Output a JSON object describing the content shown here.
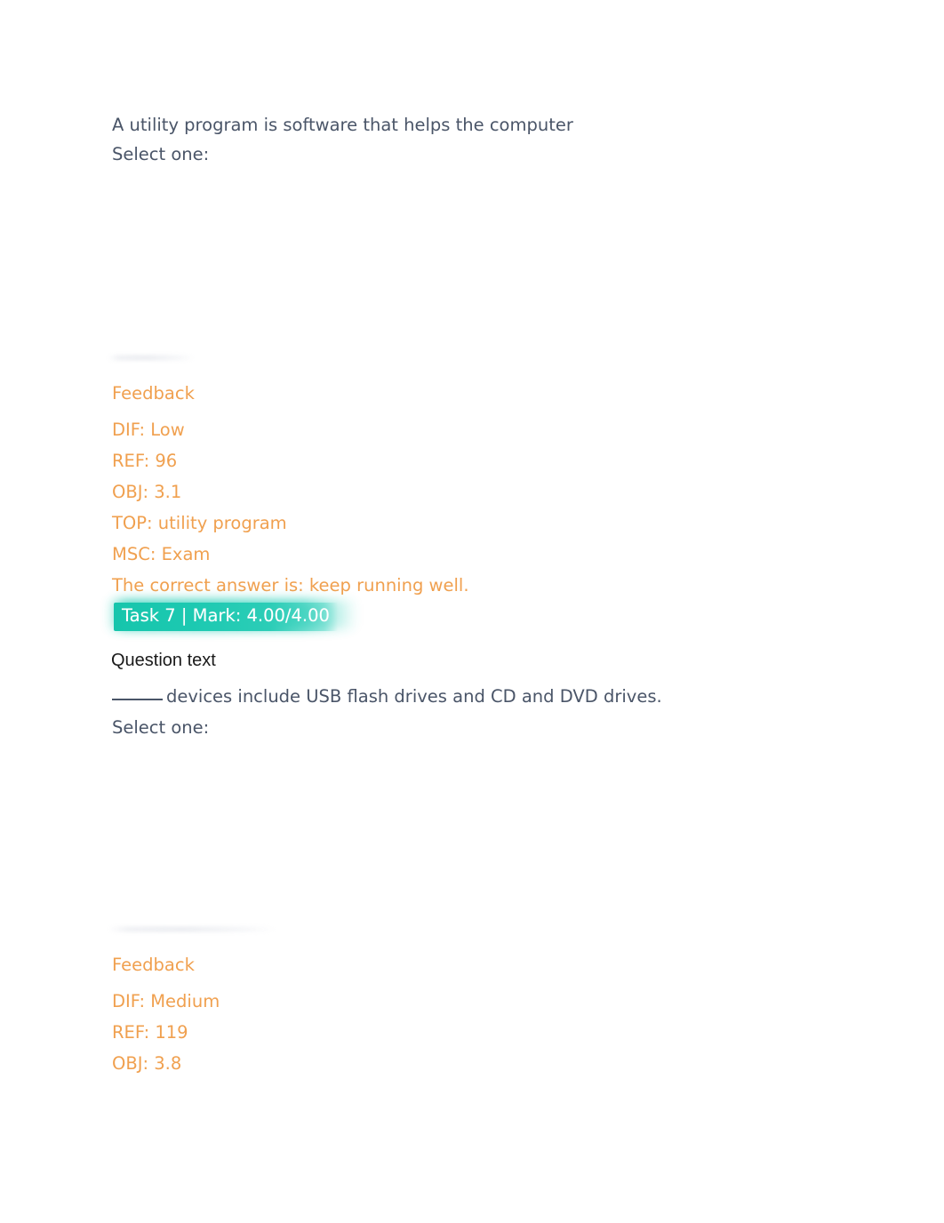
{
  "page": {
    "background_color": "#ffffff",
    "body_text_color": "#4a5568",
    "feedback_text_color": "#f0a04f",
    "heading_text_color": "#1a1a1a",
    "badge_color": "#1cc9b1",
    "badge_text_color": "#ffffff"
  },
  "question_1": {
    "stem": "A utility program is software that helps the computer",
    "select_prompt": "Select one:",
    "options": [],
    "feedback": {
      "title": "Feedback",
      "lines": [
        "DIF: Low",
        "REF: 96",
        "OBJ: 3.1",
        "TOP: utility program",
        "MSC: Exam",
        "The correct answer is: keep running well."
      ]
    }
  },
  "task_badge": {
    "text": "Task 7 | Mark: 4.00/4.00",
    "task_label": "Task 7",
    "separator": "|",
    "mark_label": "Mark:",
    "mark_value": "4.00/4.00"
  },
  "question_2": {
    "heading": "Question text",
    "blank_prefix": "",
    "stem": "devices include USB flash drives and CD and DVD drives.",
    "select_prompt": "Select one:",
    "options": [],
    "feedback": {
      "title": "Feedback",
      "lines": [
        "DIF: Medium",
        "REF: 119",
        "OBJ: 3.8"
      ]
    }
  }
}
